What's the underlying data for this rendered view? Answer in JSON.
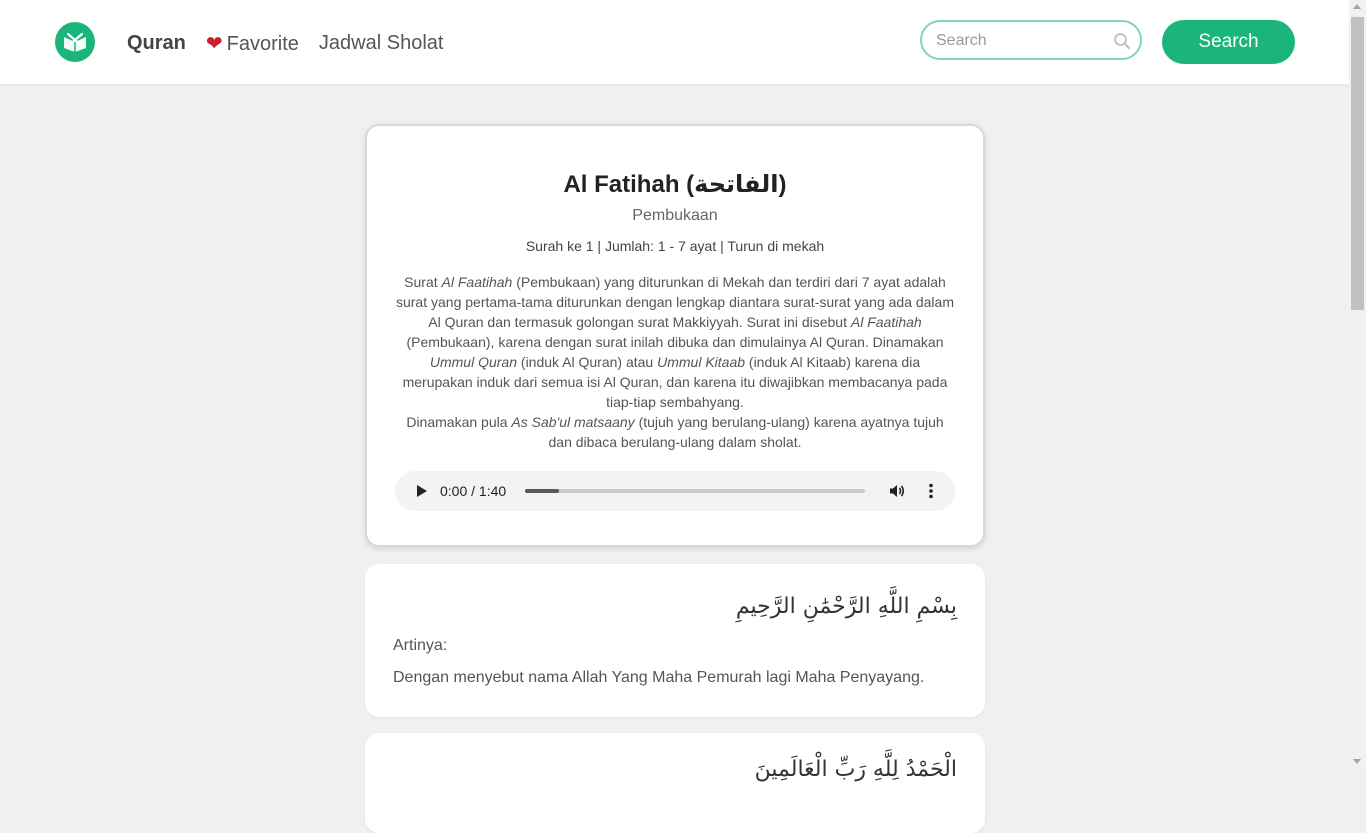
{
  "nav": {
    "logo_icon": "quran-book-icon",
    "brand_color": "#1bb57c",
    "links": [
      {
        "label": "Quran"
      },
      {
        "label": "Favorite",
        "icon": "heart-icon"
      },
      {
        "label": "Jadwal Sholat"
      }
    ],
    "search_placeholder": "Search",
    "search_button": "Search"
  },
  "surah": {
    "title": "Al Fatihah (الفاتحة)",
    "meaning": "Pembukaan",
    "meta": "Surah ke 1 | Jumlah: 1 - 7 ayat | Turun di mekah",
    "description": [
      {
        "t": "Surat "
      },
      {
        "t": "Al Faatihah",
        "i": true
      },
      {
        "t": " (Pembukaan) yang diturunkan di Mekah dan terdiri dari 7 ayat adalah surat yang pertama-tama diturunkan dengan lengkap diantara surat-surat yang ada dalam Al Quran dan termasuk golongan surat Makkiyyah. Surat ini disebut "
      },
      {
        "t": "Al Faatihah",
        "i": true
      },
      {
        "t": " (Pembukaan), karena dengan surat inilah dibuka dan dimulainya Al Quran. Dinamakan "
      },
      {
        "t": "Ummul Quran",
        "i": true
      },
      {
        "t": " (induk Al Quran) atau "
      },
      {
        "t": "Ummul Kitaab",
        "i": true
      },
      {
        "t": " (induk Al Kitaab) karena dia merupakan induk dari semua isi Al Quran, dan karena itu diwajibkan membacanya pada tiap-tiap sembahyang."
      },
      {
        "br": true
      },
      {
        "t": "Dinamakan pula "
      },
      {
        "t": "As Sab'ul matsaany",
        "i": true
      },
      {
        "t": " (tujuh yang berulang-ulang) karena ayatnya tujuh dan dibaca berulang-ulang dalam sholat."
      }
    ],
    "audio": {
      "time": "0:00 / 1:40",
      "progress": 0.1
    }
  },
  "ayahs": [
    {
      "arabic": "بِسْمِ اللَّهِ الرَّحْمَٰنِ الرَّحِيمِ",
      "label": "Artinya:",
      "translation": "Dengan menyebut nama Allah Yang Maha Pemurah lagi Maha Penyayang."
    },
    {
      "arabic": "الْحَمْدُ لِلَّهِ رَبِّ الْعَالَمِينَ"
    }
  ]
}
